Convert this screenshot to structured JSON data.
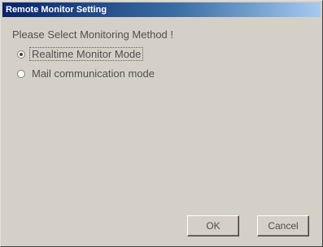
{
  "window": {
    "title": "Remote Monitor Setting"
  },
  "prompt": "Please Select Monitoring Method !",
  "options": [
    {
      "label": "Realtime Monitor Mode",
      "selected": true
    },
    {
      "label": "Mail communication mode",
      "selected": false
    }
  ],
  "buttons": {
    "ok_label": "OK",
    "cancel_label": "Cancel"
  },
  "colors": {
    "dialog_bg": "#d4d0c8",
    "title_start": "#0a246a",
    "title_end": "#a6caf0"
  }
}
